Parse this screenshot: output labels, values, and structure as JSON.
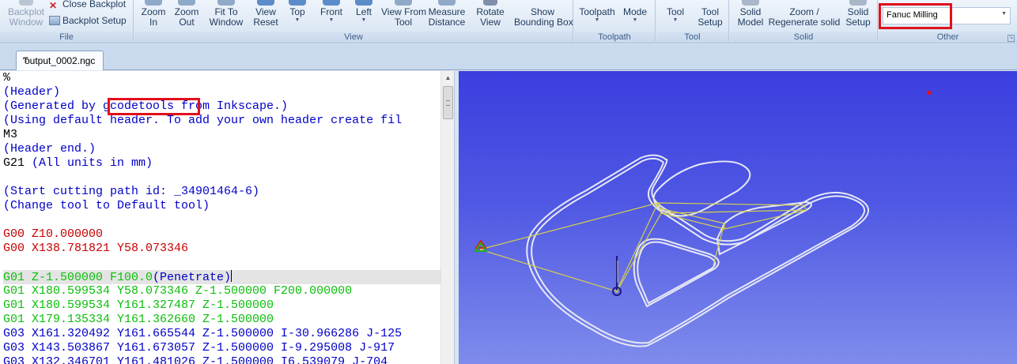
{
  "ribbon": {
    "groups": {
      "file": "File",
      "view": "View",
      "toolpath": "Toolpath",
      "tool": "Tool",
      "solid": "Solid",
      "other": "Other"
    },
    "file": {
      "backplot_window": "Backplot\nWindow",
      "close_backplot": "Close Backplot",
      "backplot_setup": "Backplot Setup"
    },
    "view": {
      "zoom_in": "Zoom\nIn",
      "zoom_out": "Zoom\nOut",
      "fit_to_window": "Fit To\nWindow",
      "view_reset": "View\nReset",
      "top": "Top",
      "front": "Front",
      "left": "Left",
      "view_from_tool": "View From\nTool",
      "measure_distance": "Measure\nDistance",
      "rotate_view": "Rotate\nView",
      "show_bounding_box": "Show\nBounding Box"
    },
    "toolpath": {
      "toolpath": "Toolpath",
      "mode": "Mode"
    },
    "tool": {
      "tool": "Tool",
      "tool_setup": "Tool\nSetup"
    },
    "solid": {
      "solid_model": "Solid\nModel",
      "zoom_regenerate": "Zoom /\nRegenerate solid",
      "solid_setup": "Solid\nSetup"
    },
    "other": {
      "machine_select": "Fanuc Milling"
    }
  },
  "document_tab": {
    "label": "output_0002.ngc",
    "icon": "document-icon"
  },
  "editor": {
    "lines": [
      {
        "text": "%",
        "kind": "plain"
      },
      {
        "text": "(Header)",
        "kind": "comment"
      },
      {
        "text": "(Generated by gcodetools from Inkscape.)",
        "kind": "comment",
        "highlight": "gcodetools"
      },
      {
        "text": "(Using default header. To add your own header create fil",
        "kind": "comment"
      },
      {
        "text": "M3",
        "kind": "plain"
      },
      {
        "text": "(Header end.)",
        "kind": "comment"
      },
      {
        "text": "G21 (All units in mm)",
        "kind": "mixed",
        "code": "G21",
        "comment": " (All units in mm)"
      },
      {
        "text": "",
        "kind": "plain"
      },
      {
        "text": "(Start cutting path id: _34901464-6)",
        "kind": "comment"
      },
      {
        "text": "(Change tool to Default tool)",
        "kind": "comment"
      },
      {
        "text": "",
        "kind": "plain"
      },
      {
        "text": "G00 Z10.000000",
        "kind": "red"
      },
      {
        "text": "G00 X138.781821 Y58.073346",
        "kind": "red"
      },
      {
        "text": "",
        "kind": "plain"
      },
      {
        "text": "G01 Z-1.500000 F100.0(Penetrate)",
        "kind": "current",
        "code": "G01 Z-1.500000 F100.0",
        "comment": "(Penetrate)"
      },
      {
        "text": "G01 X180.599534 Y58.073346 Z-1.500000 F200.000000",
        "kind": "green"
      },
      {
        "text": "G01 X180.599534 Y161.327487 Z-1.500000",
        "kind": "green"
      },
      {
        "text": "G01 X179.135334 Y161.362660 Z-1.500000",
        "kind": "green"
      },
      {
        "text": "G03 X161.320492 Y161.665544 Z-1.500000 I-30.966286 J-125",
        "kind": "blue"
      },
      {
        "text": "G03 X143.503867 Y161.673057 Z-1.500000 I-9.295008 J-917",
        "kind": "blue"
      },
      {
        "text": "G03 X132.346701 Y161.481026 Z-1.500000 I6.539079 J-704",
        "kind": "blue"
      }
    ]
  },
  "colors": {
    "highlight_box": "#e0101b",
    "comment": "#0000c8",
    "rapid": "#c80000",
    "feed": "#0bbf0b"
  }
}
